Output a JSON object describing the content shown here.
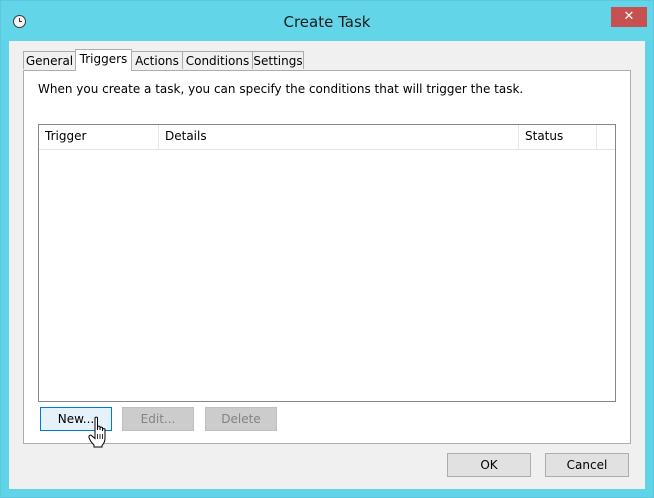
{
  "window": {
    "title": "Create Task",
    "close_label": "✕"
  },
  "tabs": [
    {
      "label": "General",
      "active": false
    },
    {
      "label": "Triggers",
      "active": true
    },
    {
      "label": "Actions",
      "active": false
    },
    {
      "label": "Conditions",
      "active": false
    },
    {
      "label": "Settings",
      "active": false
    }
  ],
  "triggers_tab": {
    "description": "When you create a task, you can specify the conditions that will trigger the task.",
    "columns": [
      "Trigger",
      "Details",
      "Status"
    ],
    "rows": [],
    "buttons": {
      "new": "New...",
      "edit": "Edit...",
      "delete": "Delete"
    }
  },
  "footer": {
    "ok": "OK",
    "cancel": "Cancel"
  },
  "icons": {
    "window_icon": "clock-icon",
    "cursor": "hand-pointer-icon"
  },
  "colors": {
    "titlebar": "#62d5e8",
    "close": "#c75050"
  }
}
